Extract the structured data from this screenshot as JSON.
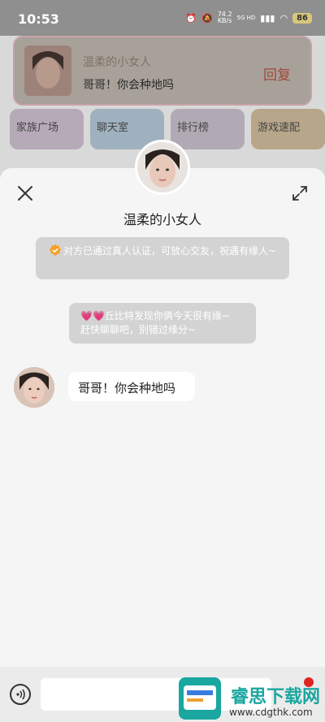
{
  "status_bar": {
    "time": "10:53",
    "speed_value": "74.2",
    "speed_unit": "KB/s",
    "network": "5G HD",
    "battery": "86"
  },
  "notification": {
    "sender_name": "温柔的小女人",
    "message": "哥哥！你会种地吗",
    "reply_label": "回复"
  },
  "tabs": [
    {
      "label": "家族广场"
    },
    {
      "label": "聊天室"
    },
    {
      "label": "排行榜"
    },
    {
      "label": "游戏速配"
    }
  ],
  "chat": {
    "title": "温柔的小女人",
    "system_verify": "对方已通过真人认证，可放心交友，祝遇有缘人~",
    "system_cupid_line1": "丘比特发现你俩今天很有缘~",
    "system_cupid_line2": "赶快聊聊吧，别错过缘分~",
    "incoming_message": "哥哥！你会种地吗"
  },
  "input": {
    "placeholder": ""
  },
  "watermark": {
    "brand": "睿思下载网",
    "url": "www.cdgthk.com"
  },
  "icons": {
    "close": "close-icon",
    "expand": "expand-icon",
    "voice": "voice-icon",
    "verify": "verified-badge-icon",
    "hearts": "heart-icon"
  },
  "colors": {
    "sheet_bg": "#f5f5f5",
    "system_bubble": "#d3d3d3",
    "verify_orange": "#f5a021",
    "heart_pink": "#e64a7d",
    "watermark_teal": "#19a7a0"
  }
}
